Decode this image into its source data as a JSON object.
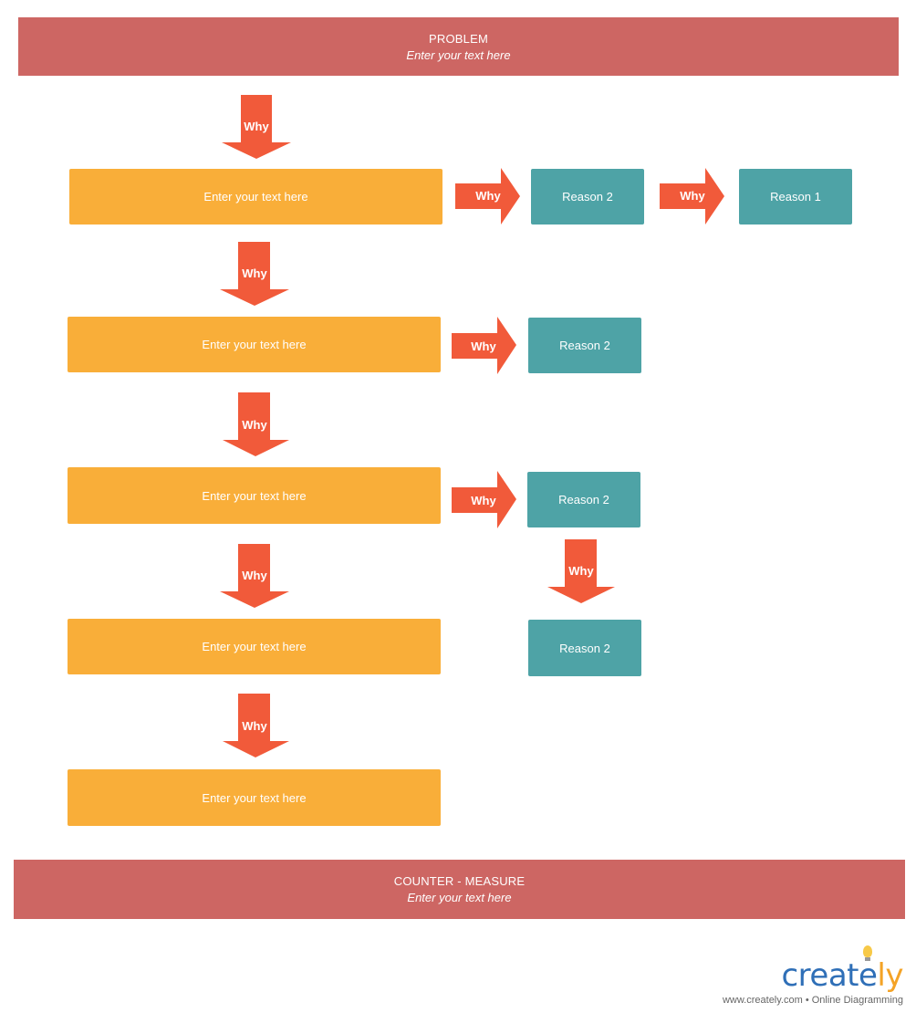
{
  "problem": {
    "title": "PROBLEM",
    "subtitle": "Enter your text here"
  },
  "counter_measure": {
    "title": "COUNTER - MEASURE",
    "subtitle": "Enter your text here"
  },
  "arrow_label": "Why",
  "why_boxes": [
    {
      "label": "Enter your text here"
    },
    {
      "label": "Enter your text here"
    },
    {
      "label": "Enter your text here"
    },
    {
      "label": "Enter your text here"
    },
    {
      "label": "Enter your text here"
    }
  ],
  "reason_boxes": [
    {
      "label": "Reason 2"
    },
    {
      "label": "Reason 1"
    },
    {
      "label": "Reason 2"
    },
    {
      "label": "Reason 2"
    },
    {
      "label": "Reason 2"
    }
  ],
  "colors": {
    "banner": "#cd6663",
    "why_box": "#f9ae39",
    "reason_box": "#4ea3a6",
    "arrow": "#f15a3a"
  },
  "branding": {
    "logo_main": "create",
    "logo_accent": "ly",
    "tagline": "www.creately.com • Online Diagramming"
  }
}
